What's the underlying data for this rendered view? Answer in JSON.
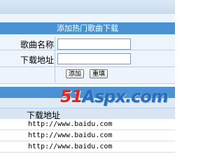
{
  "form": {
    "title": "添加热门歌曲下载",
    "song_name_label": "歌曲名称",
    "song_name_value": "",
    "download_url_label": "下载地址",
    "download_url_value": "",
    "add_button": "添加",
    "reset_button": "重填"
  },
  "list": {
    "column_header": "下载地址",
    "rows": [
      {
        "url": "http://www.baidu.com"
      },
      {
        "url": "http://www.baidu.com"
      },
      {
        "url": "http://www.baidu.com"
      }
    ]
  },
  "watermark": {
    "prefix": "51",
    "middle": "Aspx",
    "suffix": ".com"
  },
  "colors": {
    "header_blue": "#4b92d4",
    "panel_bg": "#eef4fb"
  }
}
